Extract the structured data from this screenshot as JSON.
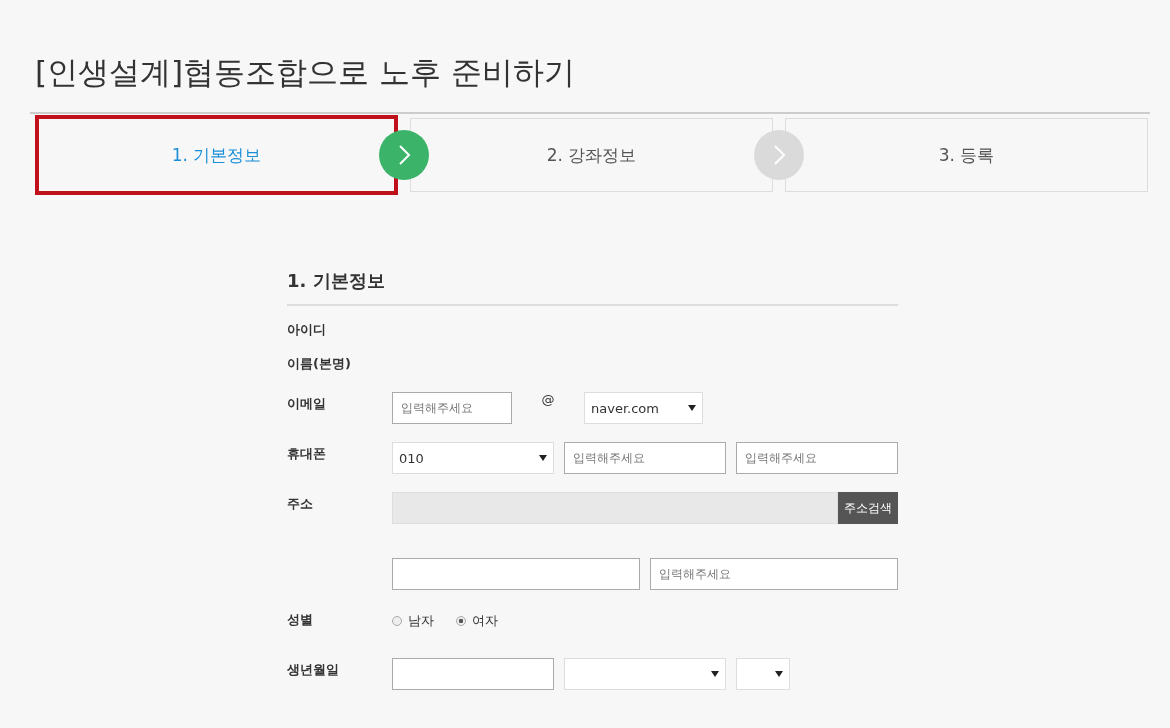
{
  "page_title": "[인생설계]협동조합으로 노후 준비하기",
  "steps": [
    {
      "label": "1. 기본정보",
      "selected": true,
      "highlighted": true,
      "arrow_active": true
    },
    {
      "label": "2. 강좌정보",
      "selected": false,
      "highlighted": false,
      "arrow_active": false
    },
    {
      "label": "3. 등록",
      "selected": false,
      "highlighted": false
    }
  ],
  "section_title": "1. 기본정보",
  "rows": [
    {
      "label": "아이디",
      "kind": "text",
      "controls": []
    },
    {
      "label": "이름(본명)",
      "kind": "text",
      "controls": []
    },
    {
      "label": "이메일",
      "kind": "email",
      "controls": [
        {
          "kind": "input",
          "placeholder": "입력해주세요"
        },
        {
          "kind": "at",
          "text": "@"
        },
        {
          "kind": "select",
          "value": "naver.com"
        }
      ]
    },
    {
      "label": "휴대폰",
      "kind": "phone",
      "controls": [
        {
          "kind": "select",
          "value": "010"
        },
        {
          "kind": "input",
          "placeholder": "입력해주세요"
        },
        {
          "kind": "input",
          "placeholder": "입력해주세요"
        }
      ]
    },
    {
      "label": "주소",
      "kind": "address",
      "controls": [
        {
          "kind": "readonly"
        },
        {
          "kind": "button",
          "text": "주소검색"
        }
      ]
    },
    {
      "kind": "address2",
      "controls": [
        {
          "kind": "input"
        },
        {
          "kind": "input",
          "placeholder": "입력해주세요"
        }
      ]
    },
    {
      "label": "성별",
      "kind": "gender",
      "controls": [
        {
          "kind": "radio",
          "text": "남자",
          "selected": false
        },
        {
          "kind": "radio",
          "text": "여자",
          "selected": true
        }
      ]
    },
    {
      "label": "생년월일",
      "kind": "birth",
      "controls": [
        {
          "kind": "input"
        },
        {
          "kind": "select"
        },
        {
          "kind": "select"
        }
      ]
    }
  ]
}
